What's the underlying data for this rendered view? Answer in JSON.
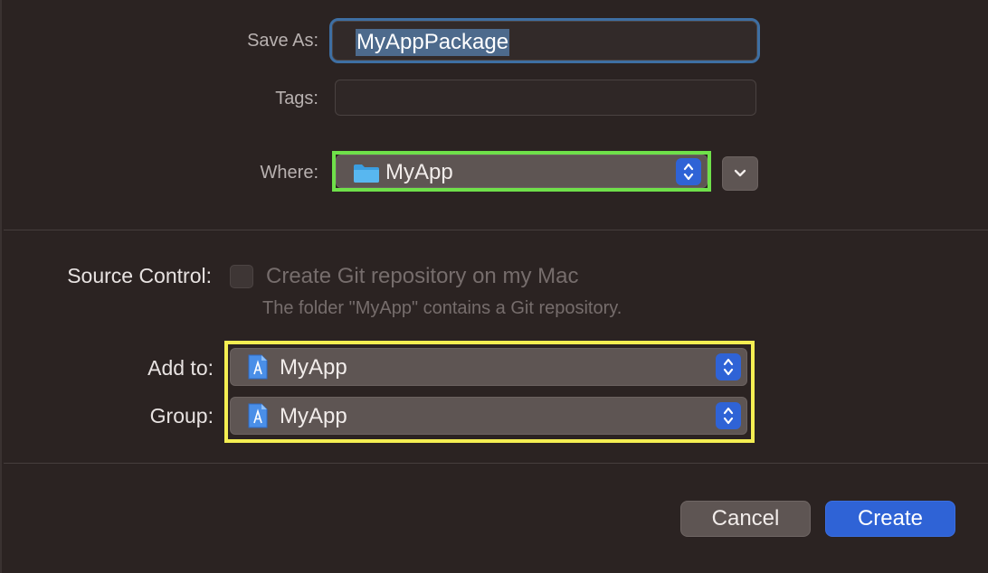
{
  "form": {
    "save_as_label": "Save As:",
    "save_as_value": "MyAppPackage",
    "tags_label": "Tags:",
    "tags_value": "",
    "where_label": "Where:",
    "where_value": "MyApp"
  },
  "source_control": {
    "label": "Source Control:",
    "checkbox_label": "Create Git repository on my Mac",
    "checked": false,
    "hint": "The folder \"MyApp\" contains a Git repository."
  },
  "project": {
    "add_to_label": "Add to:",
    "add_to_value": "MyApp",
    "group_label": "Group:",
    "group_value": "MyApp"
  },
  "buttons": {
    "cancel": "Cancel",
    "create": "Create"
  },
  "icons": {
    "where": "folder-icon",
    "add_to": "xcode-project-icon",
    "group": "xcode-project-icon",
    "disclosure": "chevron-down-icon"
  },
  "colors": {
    "background": "#2b2322",
    "accent": "#2f63d6",
    "green_highlight": "#6fe04a",
    "yellow_highlight": "#f4ee52"
  }
}
